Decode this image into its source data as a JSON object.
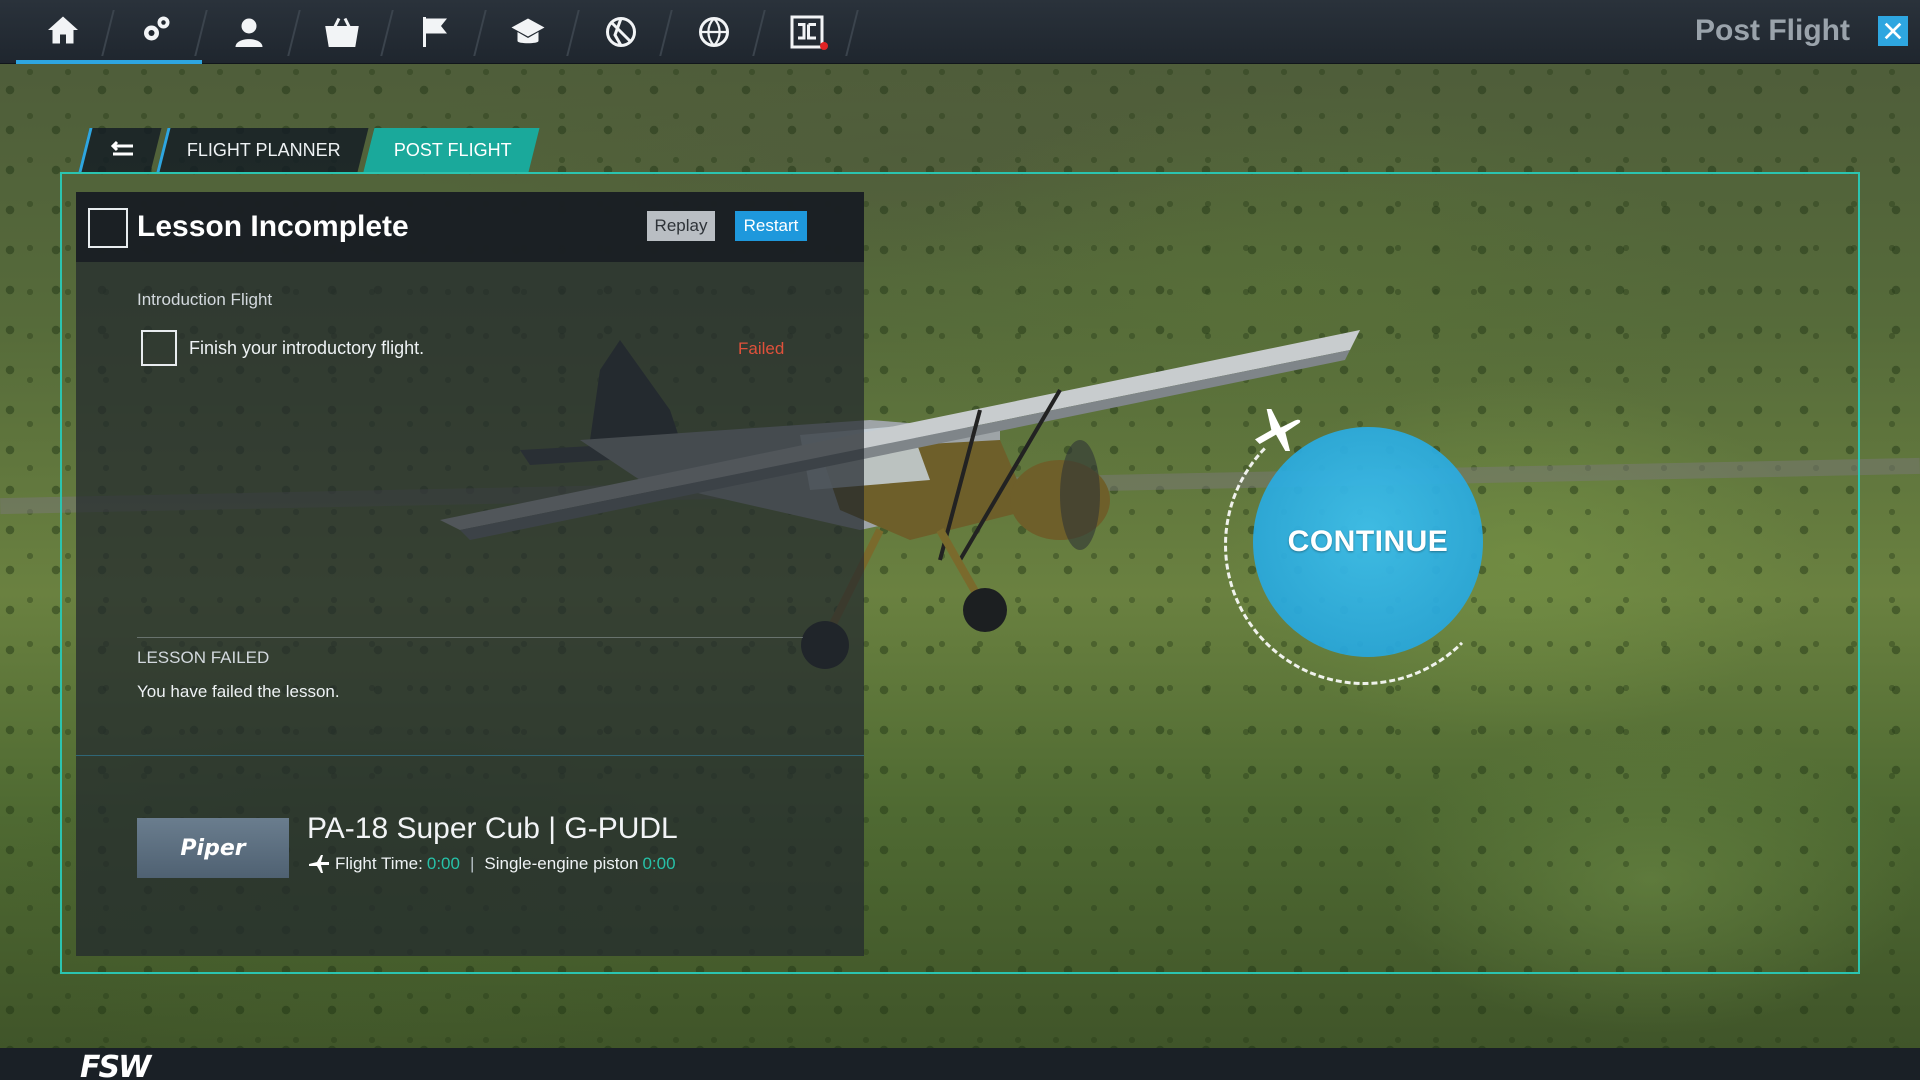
{
  "window": {
    "title": "Post Flight"
  },
  "nav": {
    "icons": [
      "home-icon",
      "settings-icon",
      "profile-icon",
      "store-icon",
      "missions-flag-icon",
      "academy-icon",
      "multiplayer-icon",
      "world-icon",
      "jetpack-dc-icon"
    ],
    "active_index": 1
  },
  "tabs": {
    "back": "back-arrow-icon",
    "flight_planner": "FLIGHT PLANNER",
    "post_flight": "POST FLIGHT"
  },
  "lesson": {
    "status_title": "Lesson Incomplete",
    "replay_label": "Replay",
    "restart_label": "Restart",
    "section_title": "Introduction Flight",
    "objective_text": "Finish your introductory flight.",
    "objective_status": "Failed",
    "result_title": "LESSON FAILED",
    "result_text": "You have failed the lesson."
  },
  "aircraft": {
    "brand": "Piper",
    "name": "PA-18 Super Cub | G-PUDL",
    "flight_time_label": "Flight Time:",
    "flight_time_value": "0:00",
    "separator": "|",
    "engine_type": "Single-engine piston",
    "engine_time": "0:00"
  },
  "continue": {
    "label": "CONTINUE"
  },
  "footer": {
    "logo": "FSW"
  },
  "colors": {
    "accent_blue": "#2ea6e0",
    "accent_teal": "#1aa99b",
    "failed_red": "#e0513b",
    "value_green": "#27c1a8"
  }
}
